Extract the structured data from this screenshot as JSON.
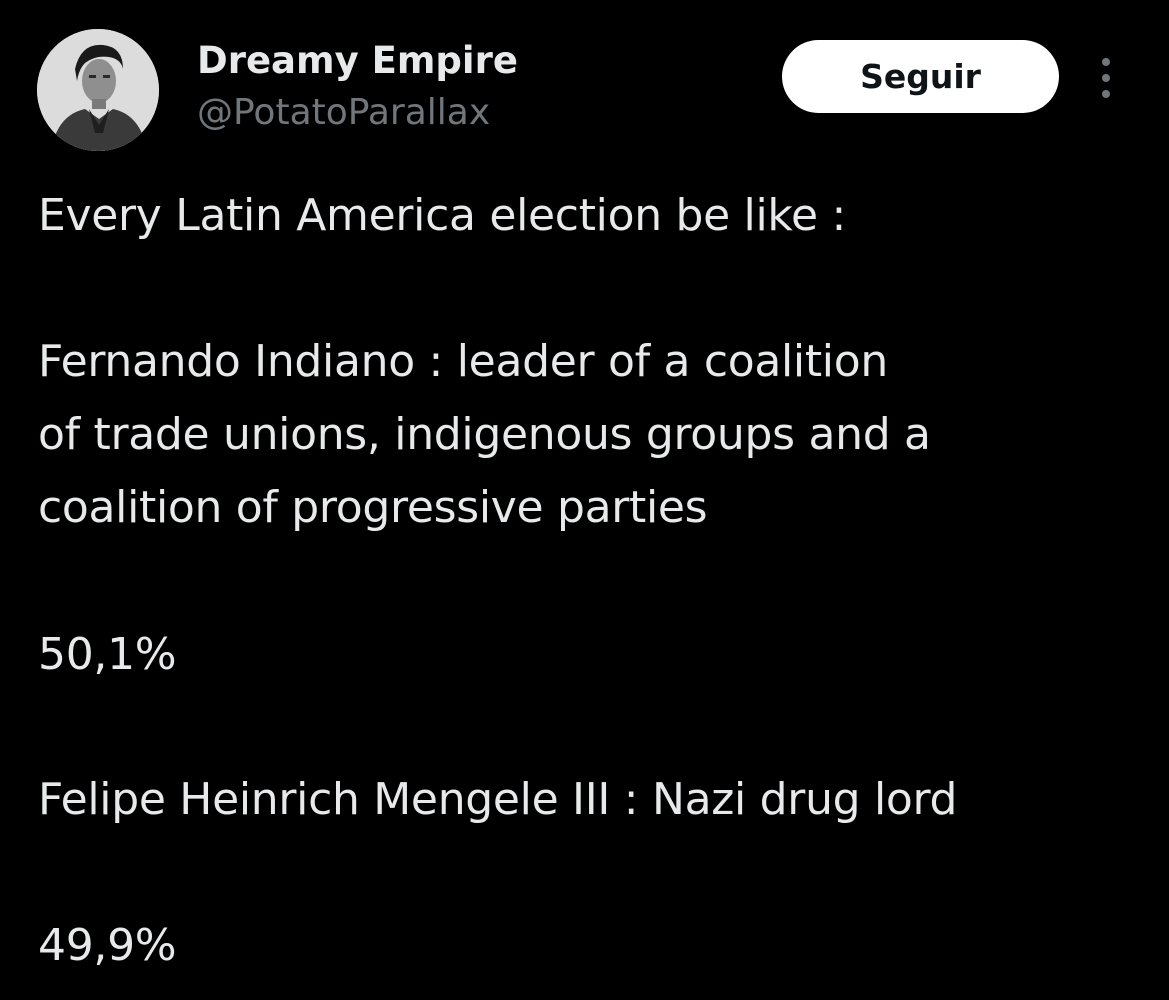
{
  "author": {
    "display_name": "Dreamy Empire",
    "handle": "@PotatoParallax",
    "avatar_icon": "profile-photo"
  },
  "actions": {
    "follow_label": "Seguir",
    "more_icon": "vertical-ellipsis"
  },
  "tweet": {
    "intro": "Every Latin America election be like :",
    "candidate_1": {
      "line_1": "Fernando Indiano : leader of a coalition",
      "line_2": "of trade unions, indigenous groups and a",
      "line_3": "coalition of progressive parties",
      "result": "50,1%"
    },
    "candidate_2": {
      "line_1": "Felipe Heinrich Mengele III : Nazi drug lord",
      "result": "49,9%"
    }
  },
  "colors": {
    "background": "#000000",
    "primary_text": "#e7e9ea",
    "secondary_text": "#71767b",
    "button_bg": "#ffffff",
    "button_text": "#0f1419"
  }
}
